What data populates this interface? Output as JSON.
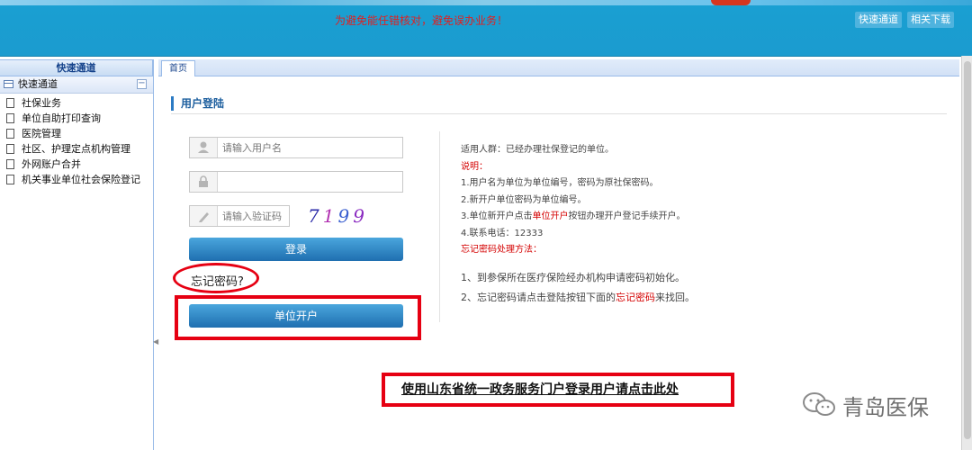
{
  "header": {
    "notice": "为避免能任错核对，避免误办业务！",
    "buttons": [
      "快速通道",
      "相关下载"
    ]
  },
  "sidebar": {
    "title": "快速通道",
    "panel_label": "快速通道",
    "items": [
      {
        "label": "社保业务"
      },
      {
        "label": "单位自助打印查询"
      },
      {
        "label": "医院管理"
      },
      {
        "label": "社区、护理定点机构管理"
      },
      {
        "label": "外网账户合并"
      },
      {
        "label": "机关事业单位社会保险登记"
      }
    ]
  },
  "tabs": [
    {
      "label": "首页"
    }
  ],
  "login": {
    "title": "用户登陆",
    "username_placeholder": "请输入用户名",
    "password_placeholder": "",
    "captcha_placeholder": "请输入验证码",
    "captcha_chars": [
      "7",
      "1",
      "9",
      "9"
    ],
    "login_button": "登录",
    "forgot_link": "忘记密码?",
    "register_button": "单位开户"
  },
  "info": {
    "audience": "适用人群：已经办理社保登记的单位。",
    "notes_heading": "说明：",
    "note1": "1.用户名为单位为单位编号，密码为原社保密码。",
    "note2": "2.新开户单位密码为单位编号。",
    "note3_prefix": "3.单位新开户点击",
    "note3_highlight": "单位开户",
    "note3_suffix": "按钮办理开户登记手续开户。",
    "note4": "4.联系电话：12333",
    "forgot_heading": "忘记密码处理方法：",
    "step1": "1、到参保所在医疗保险经办机构申请密码初始化。",
    "step2_prefix": "2、忘记密码请点击登陆按钮下面的",
    "step2_highlight": "忘记密码",
    "step2_suffix": "来找回。"
  },
  "gov_link": "使用山东省统一政务服务门户登录用户请点击此处",
  "watermark": "青岛医保",
  "colors": {
    "accent": "#1b9bcf",
    "highlight_red": "#e60012",
    "button_blue": "#1f6fb0"
  }
}
